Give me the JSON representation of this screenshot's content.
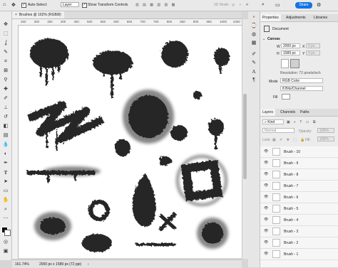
{
  "options_bar": {
    "auto_select_label": "Auto-Select:",
    "auto_select_value": "Layer",
    "transform_label": "Show Transform Controls",
    "mode_3d": "3D Mode:",
    "share_label": "Share"
  },
  "document": {
    "tab_title": "Brushes @ 162% (RGB/8)",
    "zoom": "161.74%",
    "status_size": "2000 px x 1589 px (72 ppi)"
  },
  "ruler_ticks": [
    "250",
    "300",
    "350",
    "400",
    "450",
    "500",
    "550",
    "600",
    "650",
    "700",
    "750",
    "800",
    "850",
    "900",
    "950",
    "1000",
    "1050"
  ],
  "properties_panel": {
    "tabs": [
      "Properties",
      "Adjustments",
      "Libraries"
    ],
    "document_label": "Document",
    "canvas_label": "Canvas",
    "width_label": "W",
    "width_value": "2000 px",
    "height_label": "H",
    "height_value": "1589 px",
    "x_label": "X",
    "y_label": "Y",
    "x_value": "0 px",
    "y_value": "0 px",
    "resolution": "Resolution: 72 pixels/inch",
    "mode_label": "Mode",
    "mode_value": "RGB Color",
    "depth_value": "8 Bits/Channel",
    "fill_label": "Fill"
  },
  "layers_panel": {
    "tabs": [
      "Layers",
      "Channels",
      "Paths"
    ],
    "filter_value": "Kind",
    "blend_mode": "Normal",
    "opacity_label": "Opacity:",
    "opacity_value": "100%",
    "lock_label": "Lock:",
    "fill_label": "Fill:",
    "fill_value": "100%",
    "layers": [
      {
        "name": "Brush - 10"
      },
      {
        "name": "Brush - 9"
      },
      {
        "name": "Brush - 8"
      },
      {
        "name": "Brush - 7"
      },
      {
        "name": "Brush - 6"
      },
      {
        "name": "Brush - 5"
      },
      {
        "name": "Brush - 4"
      },
      {
        "name": "Brush - 3"
      },
      {
        "name": "Brush - 2"
      },
      {
        "name": "Brush - 1"
      }
    ]
  },
  "tool_icons": [
    "move-icon",
    "marquee-icon",
    "lasso-icon",
    "quick-select-icon",
    "crop-icon",
    "frame-icon",
    "eyedropper-icon",
    "healing-icon",
    "brush-icon",
    "stamp-icon",
    "history-brush-icon",
    "eraser-icon",
    "gradient-icon",
    "blur-icon",
    "dodge-icon",
    "pen-icon",
    "type-icon",
    "path-select-icon",
    "rectangle-icon",
    "hand-icon",
    "zoom-icon",
    "more-icon"
  ],
  "colors": {
    "accent": "#1473e6",
    "ink": "#262626",
    "panel_bg": "#ececec"
  }
}
